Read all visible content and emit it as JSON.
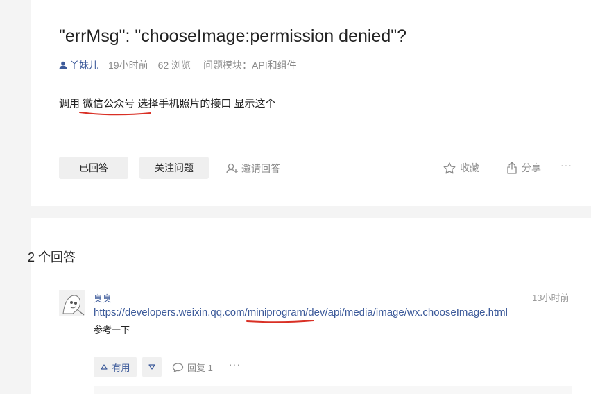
{
  "question": {
    "title": "\"errMsg\": \"chooseImage:permission denied\"?",
    "author": "丫妹儿",
    "time": "19小时前",
    "views": "62 浏览",
    "module_label": "问题模块：",
    "module": "API和组件",
    "body_prefix": "调用 ",
    "body_highlight": "微信公众号",
    "body_suffix": " 选择手机照片的接口 显示这个",
    "buttons": {
      "answered": "已回答",
      "follow": "关注问题",
      "invite": "邀请回答"
    },
    "actions": {
      "favorite": "收藏",
      "share": "分享",
      "more": "···"
    }
  },
  "answers": {
    "count_label": "2 个回答",
    "items": [
      {
        "user": "臭臭",
        "time": "13小时前",
        "link_prefix": "https://developers.weixin.qq.com/",
        "link_highlight": "miniprogram",
        "link_suffix": "/dev/api/media/image/wx.chooseImage.html",
        "text": "参考一下",
        "upvote_label": "有用",
        "reply_label": "回复 1",
        "more": "···"
      }
    ]
  },
  "colors": {
    "link": "#3c5a9a",
    "annotation": "#d93025",
    "muted": "#8a8a8a",
    "button_bg": "#efefef"
  }
}
